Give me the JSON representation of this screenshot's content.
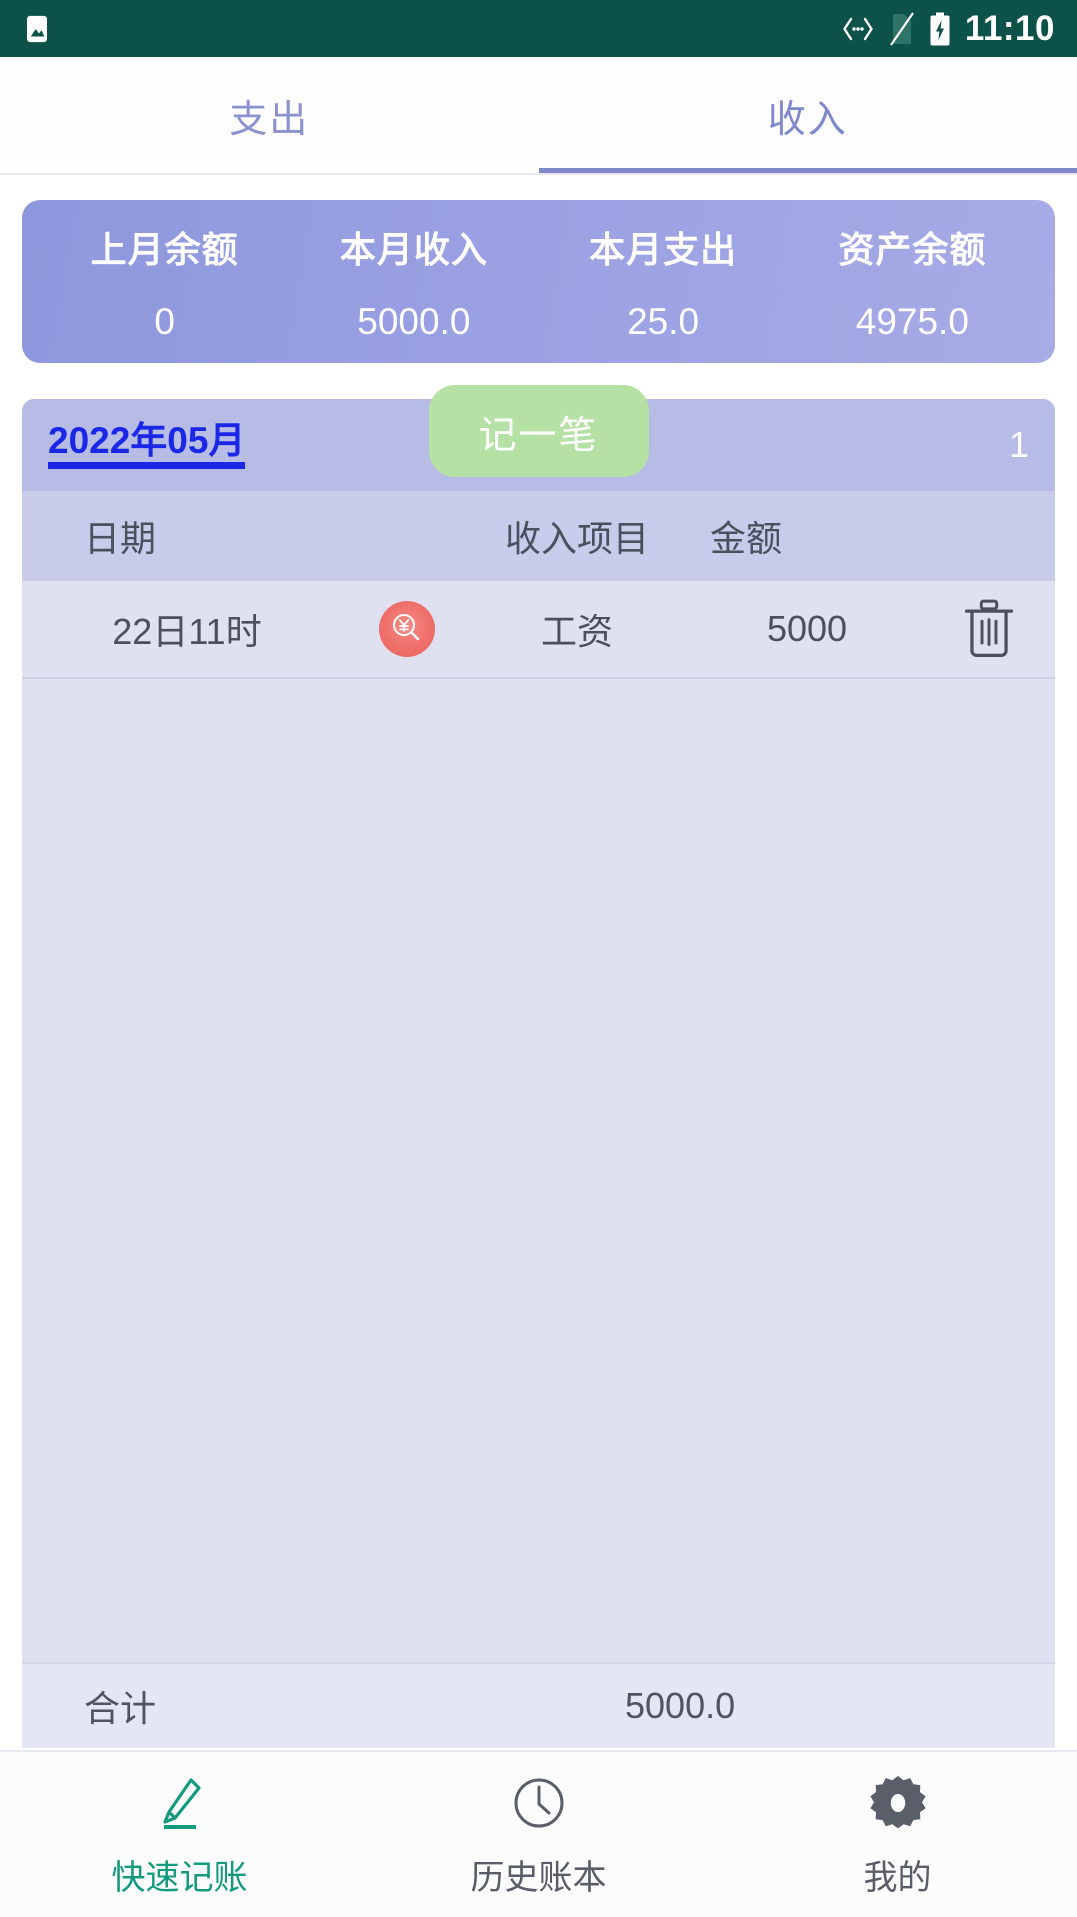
{
  "status_bar": {
    "time": "11:10",
    "icons": [
      "image-icon",
      "cast-icon",
      "sim-card-off-icon",
      "battery-charging-icon"
    ]
  },
  "tabs": {
    "items": [
      {
        "label": "支出",
        "active": false
      },
      {
        "label": "收入",
        "active": true
      }
    ]
  },
  "summary": {
    "columns": [
      {
        "label": "上月余额",
        "value": "0"
      },
      {
        "label": "本月收入",
        "value": "5000.0"
      },
      {
        "label": "本月支出",
        "value": "25.0"
      },
      {
        "label": "资产余额",
        "value": "4975.0"
      }
    ]
  },
  "ledger": {
    "month": "2022年05月",
    "record_button": "记一笔",
    "entry_count": "1",
    "table_headers": {
      "date": "日期",
      "item": "收入项目",
      "amount": "金额"
    },
    "rows": [
      {
        "date": "22日11时",
        "icon": "money-search-icon",
        "item": "工资",
        "amount": "5000",
        "delete_icon": "trash-icon"
      }
    ],
    "total": {
      "label": "合计",
      "value": "5000.0"
    }
  },
  "bottom_nav": {
    "items": [
      {
        "label": "快速记账",
        "icon": "pen-edit-icon",
        "active": true
      },
      {
        "label": "历史账本",
        "icon": "clock-icon",
        "active": false
      },
      {
        "label": "我的",
        "icon": "gear-icon",
        "active": false
      }
    ]
  },
  "colors": {
    "status_bar_bg": "#0c5248",
    "tab_accent": "#7f88cc",
    "summary_gradient_start": "#8e97dd",
    "summary_gradient_end": "#a7abe6",
    "record_button_bg": "#b5e2a4",
    "month_link": "#1a27e6",
    "nav_active": "#149b7e",
    "money_icon": "#ef6f6a"
  }
}
